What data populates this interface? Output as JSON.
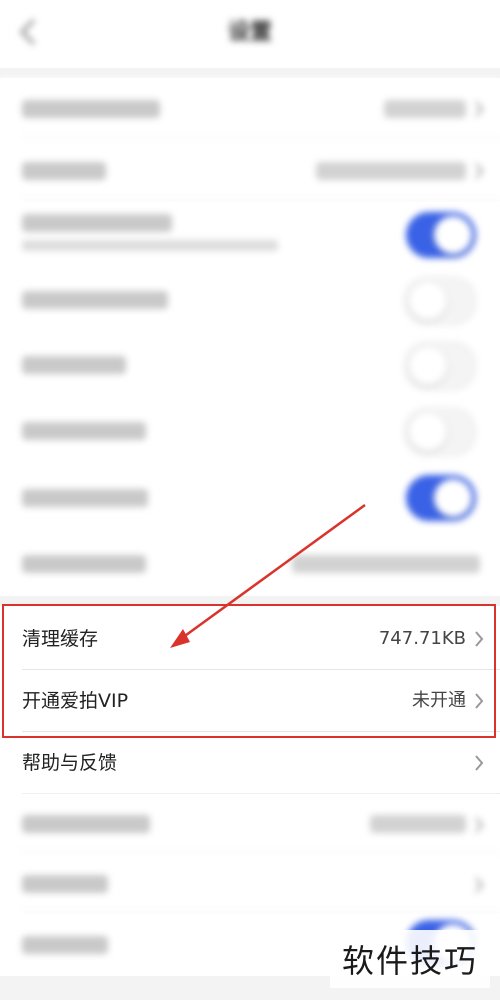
{
  "header": {
    "title": "设置"
  },
  "settings": {
    "clear_cache": {
      "label": "清理缓存",
      "value": "747.71KB"
    },
    "vip": {
      "label": "开通爱拍VIP",
      "value": "未开通"
    },
    "help": {
      "label": "帮助与反馈"
    }
  },
  "toggles": [
    {
      "name": "toggle-1",
      "state": "on"
    },
    {
      "name": "toggle-2",
      "state": "off"
    },
    {
      "name": "toggle-3",
      "state": "off"
    },
    {
      "name": "toggle-4",
      "state": "off"
    },
    {
      "name": "toggle-5",
      "state": "on"
    }
  ],
  "colors": {
    "accent": "#3a62e6",
    "highlight": "#d9342c"
  },
  "watermark": {
    "text": "软件技巧"
  }
}
